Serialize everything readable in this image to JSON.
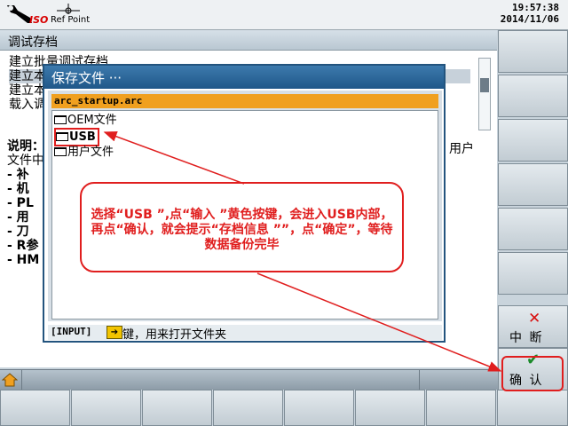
{
  "header": {
    "mode_label": "ISO",
    "ref_point_label": "Ref Point",
    "time": "19:57:38",
    "date": "2014/11/06"
  },
  "screen_title": "调试存档",
  "background_menu": [
    "建立批量调试存档",
    "建立本",
    "建立本",
    "载入调"
  ],
  "background_description": {
    "lines": [
      "说明：",
      "文件中",
      " - 补",
      " - 机",
      " - PL",
      " - 用",
      " - 刀",
      " - R参",
      " - HM"
    ],
    "right_text": "用户"
  },
  "dialog": {
    "title": "保存文件 ···",
    "filename": "arc_startup.arc",
    "items": [
      {
        "label": "OEM文件",
        "icon": "folder-icon"
      },
      {
        "label": "USB",
        "icon": "folder-icon",
        "selected": true
      },
      {
        "label": "用户文件",
        "icon": "folder-icon"
      }
    ],
    "footer_tag": "[INPUT]",
    "footer_key_icon": "input-key-icon",
    "footer_text": "键，用来打开文件夹"
  },
  "softkeys": {
    "cancel_label": "中 断",
    "ok_label": "确 认"
  },
  "annotation": {
    "text": "选择“USB ”,点“输入 ”黄色按键，会进入USB内部，再点“确认，就会提示“存档信息 ””，点“确定”，等待数据备份完毕",
    "color": "#e01e1e"
  }
}
